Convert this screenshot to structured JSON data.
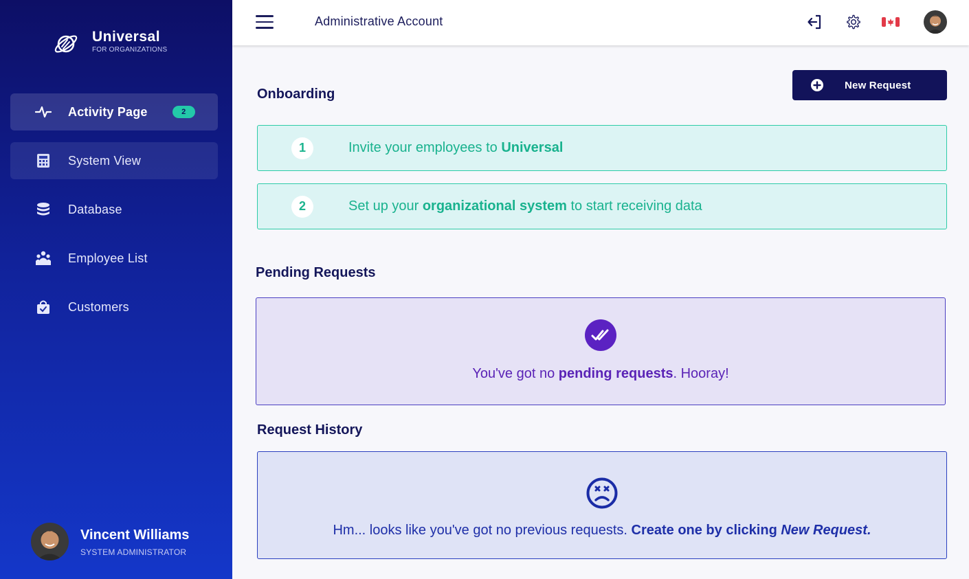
{
  "sidebar": {
    "brand": {
      "title": "Universal",
      "subtitle": "FOR ORGANIZATIONS"
    },
    "items": [
      {
        "label": "Activity Page",
        "icon": "pulse-icon",
        "badge": "2",
        "state": "active"
      },
      {
        "label": "System View",
        "icon": "calculator-icon",
        "state": "hover"
      },
      {
        "label": "Database",
        "icon": "database-icon"
      },
      {
        "label": "Employee List",
        "icon": "people-icon"
      },
      {
        "label": "Customers",
        "icon": "shopping-bag-icon"
      }
    ],
    "user": {
      "name": "Vincent Williams",
      "role": "SYSTEM ADMINISTRATOR"
    }
  },
  "topbar": {
    "title": "Administrative Account",
    "icons": [
      "menu-icon",
      "logout-icon",
      "gear-icon",
      "canada-flag-icon",
      "avatar"
    ]
  },
  "main": {
    "new_request_label": "New Request",
    "onboarding": {
      "title": "Onboarding",
      "steps": [
        {
          "num": "1",
          "pre": "Invite your employees to ",
          "bold": "Universal",
          "post": ""
        },
        {
          "num": "2",
          "pre": "Set up your ",
          "bold": "organizational system",
          "post": " to start receiving data"
        }
      ]
    },
    "pending": {
      "title": "Pending Requests",
      "pre": "You've got no ",
      "bold": "pending requests",
      "post": ". Hooray!"
    },
    "history": {
      "title": "Request History",
      "pre": "Hm... looks like you've got no previous requests. ",
      "bold": "Create one by clicking ",
      "italic": "New Request."
    }
  },
  "colors": {
    "sidebar_top": "#0d0f66",
    "sidebar_bottom": "#1437c9",
    "accent_teal": "#23c9a9",
    "button_dark": "#12135a",
    "pending_purple": "#5a23b6",
    "history_blue": "#1e2fa8"
  }
}
